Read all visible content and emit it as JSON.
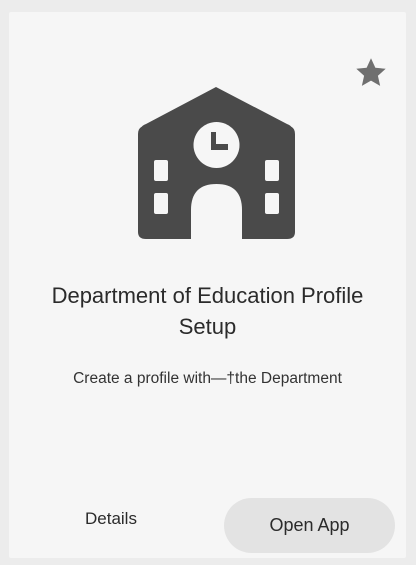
{
  "card": {
    "icon": "school-building-icon",
    "favorite_icon": "star-icon",
    "title": "Department of Education Profile Setup",
    "description": "Create a profile with—†the Department",
    "details_label": "Details",
    "open_label": "Open App",
    "colors": {
      "icon": "#4a4a4a",
      "star": "#6f6f6f",
      "card_background": "#f6f6f6",
      "button_background": "#e3e3e3"
    }
  }
}
